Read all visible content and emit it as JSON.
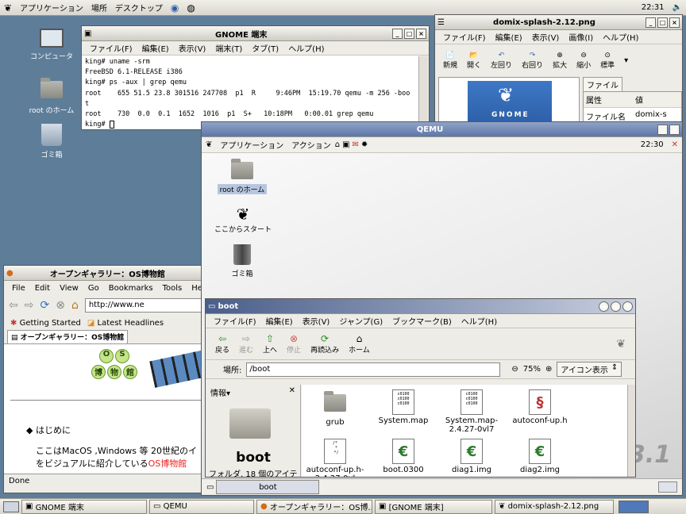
{
  "top_panel": {
    "menus": [
      "アプリケーション",
      "場所",
      "デスクトップ"
    ],
    "clock": "22:31"
  },
  "desktop": {
    "icons": [
      "コンピュータ",
      "root のホーム",
      "ゴミ箱"
    ]
  },
  "terminal": {
    "title": "GNOME 端末",
    "menus": [
      "ファイル(F)",
      "編集(E)",
      "表示(V)",
      "端末(T)",
      "タブ(T)",
      "ヘルプ(H)"
    ],
    "lines": [
      "king# uname -srm",
      "FreeBSD 6.1-RELEASE i386",
      "king# ps -aux | grep qemu",
      "root    655 51.5 23.8 301516 247708  p1  R     9:46PM  15:19.70 qemu -m 256 -boo",
      "t",
      "root    730  0.0  0.1  1652  1016  p1  S+   10:18PM   0:00.01 grep qemu",
      "king# "
    ]
  },
  "image_viewer": {
    "title": "domix-splash-2.12.png",
    "menus": [
      "ファイル(F)",
      "編集(E)",
      "表示(V)",
      "画像(I)",
      "ヘルプ(H)"
    ],
    "tools": [
      "新規",
      "開く",
      "左回り",
      "右回り",
      "拡大",
      "縮小",
      "標準"
    ],
    "tab": "ファイル",
    "col1": "属性",
    "col2": "値",
    "row_key": "ファイル名",
    "row_val": "domix-s",
    "splash_text": "GNOME"
  },
  "firefox": {
    "title": "オープンギャラリー：OS博物館",
    "menus": [
      "File",
      "Edit",
      "View",
      "Go",
      "Bookmarks",
      "Tools",
      "Help"
    ],
    "url": "http://www.ne",
    "bookmarks": [
      "Getting Started",
      "Latest Headlines"
    ],
    "tab": "オープンギャラリー：OS博物館",
    "logo_chars": [
      "O",
      "S",
      "博",
      "物",
      "館"
    ],
    "bullet": "はじめに",
    "para1": "ここはMacOS ,Windows 等 20世紀のイ",
    "para2a": "をビジュアルに紹介している",
    "para2b": "OS博物館",
    "status": "Done"
  },
  "qemu": {
    "title": "QEMU",
    "inner_menus": [
      "アプリケーション",
      "アクション"
    ],
    "clock": "22:30",
    "icons": [
      "root のホーム",
      "ここからスタート",
      "ゴミ箱"
    ],
    "bg_text": "3.1"
  },
  "nautilus": {
    "title": "boot",
    "menus": [
      "ファイル(F)",
      "編集(E)",
      "表示(V)",
      "ジャンプ(G)",
      "ブックマーク(B)",
      "ヘルプ(H)"
    ],
    "tools": [
      "戻る",
      "進む",
      "上へ",
      "停止",
      "再読込み",
      "ホーム"
    ],
    "location_label": "場所:",
    "location": "/boot",
    "zoom": "75%",
    "view_mode": "アイコン表示",
    "side_header": "情報",
    "folder_name": "boot",
    "folder_info": "フォルダ, 18 個のアイテ",
    "files": [
      "grub",
      "System.map",
      "System.map-2.4.27-0vl7",
      "autoconf-up.h",
      "autoconf-up.h-2.4.27-0vl",
      "boot.0300",
      "diag1.img",
      "diag2.img"
    ],
    "status_task": "boot"
  },
  "taskbar": [
    "GNOME 端末",
    "QEMU",
    "オープンギャラリー：OS博...",
    "[GNOME 端末]",
    "domix-splash-2.12.png"
  ]
}
